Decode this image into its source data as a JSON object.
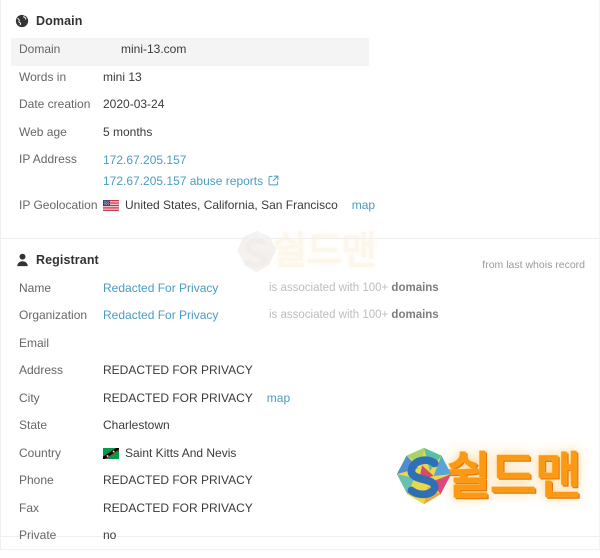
{
  "watermarks": [
    {
      "name": "shieldman-watermark-faded",
      "text": "쉴드맨"
    },
    {
      "name": "shieldman-watermark",
      "text": "쉴드맨"
    }
  ],
  "domain_section": {
    "icon": "globe-icon",
    "title": "Domain",
    "rows": [
      {
        "label": "Domain",
        "value": "mini-13.com",
        "highlight": true
      },
      {
        "label": "Words in",
        "value": "mini 13"
      },
      {
        "label": "Date creation",
        "value": "2020-03-24"
      },
      {
        "label": "Web age",
        "value": "5 months"
      },
      {
        "label": "IP Address",
        "value": "172.67.205.157",
        "value2": "172.67.205.157 abuse reports",
        "link": true,
        "external": true
      },
      {
        "label": "IP Geolocation",
        "value": "United States, California, San Francisco",
        "flag": "us-flag-icon",
        "map": "map"
      }
    ]
  },
  "registrant_section": {
    "icon": "person-icon",
    "title": "Registrant",
    "note": "from last whois record",
    "rows": [
      {
        "label": "Name",
        "value": "Redacted For Privacy",
        "link": true,
        "assoc_prefix": "is associated with 100+ ",
        "assoc_bold": "domains"
      },
      {
        "label": "Organization",
        "value": "Redacted For Privacy",
        "link": true,
        "assoc_prefix": "is associated with 100+ ",
        "assoc_bold": "domains"
      },
      {
        "label": "Email",
        "value": ""
      },
      {
        "label": "Address",
        "value": "REDACTED FOR PRIVACY"
      },
      {
        "label": "City",
        "value": "REDACTED FOR PRIVACY",
        "map": "map"
      },
      {
        "label": "State",
        "value": "Charlestown"
      },
      {
        "label": "Country",
        "value": "Saint Kitts And Nevis",
        "flag": "kn-flag-icon"
      },
      {
        "label": "Phone",
        "value": "REDACTED FOR PRIVACY"
      },
      {
        "label": "Fax",
        "value": "REDACTED FOR PRIVACY"
      },
      {
        "label": "Private",
        "value": "no"
      }
    ]
  },
  "colors": {
    "link": "#4b9cc4",
    "label": "#666666",
    "value": "#3a3a3a",
    "muted": "#bdbdbd",
    "highlight_bg": "#f4f4f4",
    "watermark_orange": "#f6a623"
  }
}
